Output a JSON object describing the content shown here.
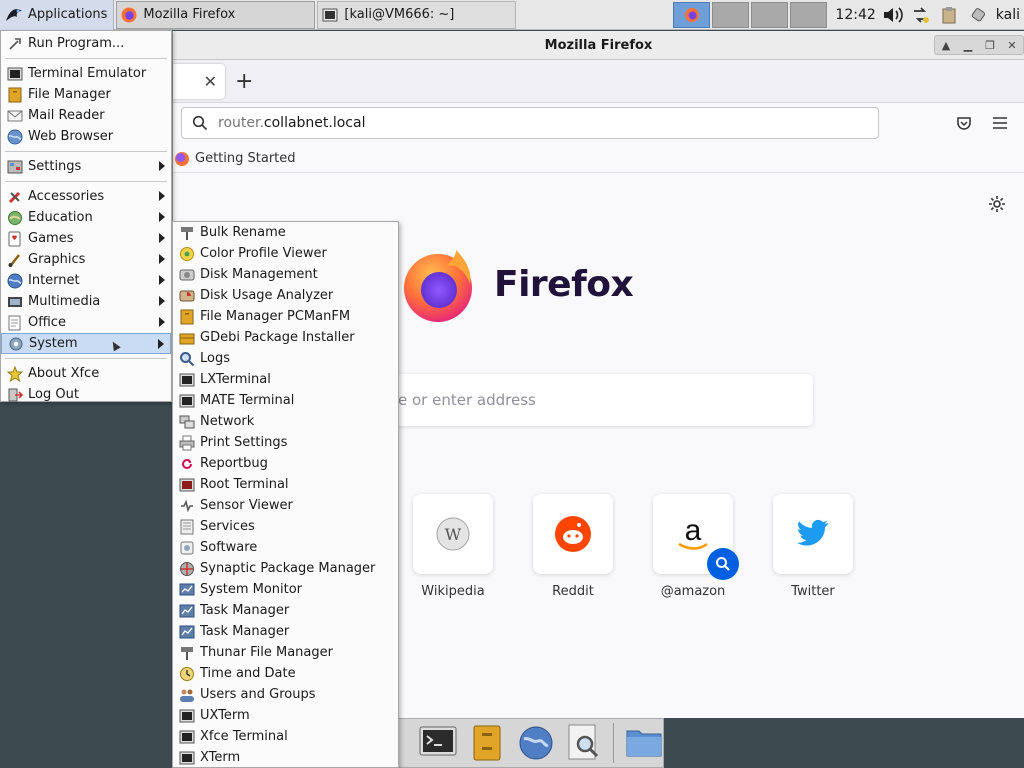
{
  "panel": {
    "applications_label": "Applications",
    "tasks": [
      {
        "label": "Mozilla Firefox"
      },
      {
        "label": "[kali@VM666: ~]"
      }
    ],
    "clock": "12:42",
    "user": "kali"
  },
  "firefox": {
    "window_title": "Mozilla Firefox",
    "url_prefix": "router.",
    "url_domain": "collabnet.local",
    "bookmark": "Getting Started",
    "brand": "Firefox",
    "search_placeholder": "e or enter address",
    "tiles": [
      {
        "label": "Wikipedia"
      },
      {
        "label": "Reddit"
      },
      {
        "label": "@amazon"
      },
      {
        "label": "Twitter"
      }
    ]
  },
  "app_menu": {
    "items": [
      {
        "label": "Run Program..."
      },
      {
        "label": "Terminal Emulator"
      },
      {
        "label": "File Manager"
      },
      {
        "label": "Mail Reader"
      },
      {
        "label": "Web Browser"
      },
      {
        "label": "Settings"
      },
      {
        "label": "Accessories"
      },
      {
        "label": "Education"
      },
      {
        "label": "Games"
      },
      {
        "label": "Graphics"
      },
      {
        "label": "Internet"
      },
      {
        "label": "Multimedia"
      },
      {
        "label": "Office"
      },
      {
        "label": "System"
      },
      {
        "label": "About Xfce"
      },
      {
        "label": "Log Out"
      }
    ]
  },
  "system_menu": {
    "items": [
      {
        "label": "Bulk Rename",
        "icon": "bulk-rename-icon"
      },
      {
        "label": "Color Profile Viewer",
        "icon": "color-profile-icon"
      },
      {
        "label": "Disk Management",
        "icon": "disk-icon"
      },
      {
        "label": "Disk Usage Analyzer",
        "icon": "disk-usage-icon"
      },
      {
        "label": "File Manager PCManFM",
        "icon": "folder-icon"
      },
      {
        "label": "GDebi Package Installer",
        "icon": "package-icon"
      },
      {
        "label": "Logs",
        "icon": "logs-icon"
      },
      {
        "label": "LXTerminal",
        "icon": "terminal-icon"
      },
      {
        "label": "MATE Terminal",
        "icon": "terminal-icon"
      },
      {
        "label": "Network",
        "icon": "network-icon"
      },
      {
        "label": "Print Settings",
        "icon": "printer-icon"
      },
      {
        "label": "Reportbug",
        "icon": "debian-icon"
      },
      {
        "label": "Root Terminal",
        "icon": "root-terminal-icon"
      },
      {
        "label": "Sensor Viewer",
        "icon": "sensor-icon"
      },
      {
        "label": "Services",
        "icon": "services-icon"
      },
      {
        "label": "Software",
        "icon": "software-icon"
      },
      {
        "label": "Synaptic Package Manager",
        "icon": "synaptic-icon"
      },
      {
        "label": "System Monitor",
        "icon": "monitor-icon"
      },
      {
        "label": "Task Manager",
        "icon": "task-manager-icon"
      },
      {
        "label": "Task Manager",
        "icon": "task-manager-icon"
      },
      {
        "label": "Thunar File Manager",
        "icon": "thunar-icon"
      },
      {
        "label": "Time and Date",
        "icon": "clock-icon"
      },
      {
        "label": "Users and Groups",
        "icon": "users-icon"
      },
      {
        "label": "UXTerm",
        "icon": "terminal-icon"
      },
      {
        "label": "Xfce Terminal",
        "icon": "terminal-icon"
      },
      {
        "label": "XTerm",
        "icon": "terminal-icon"
      }
    ]
  }
}
